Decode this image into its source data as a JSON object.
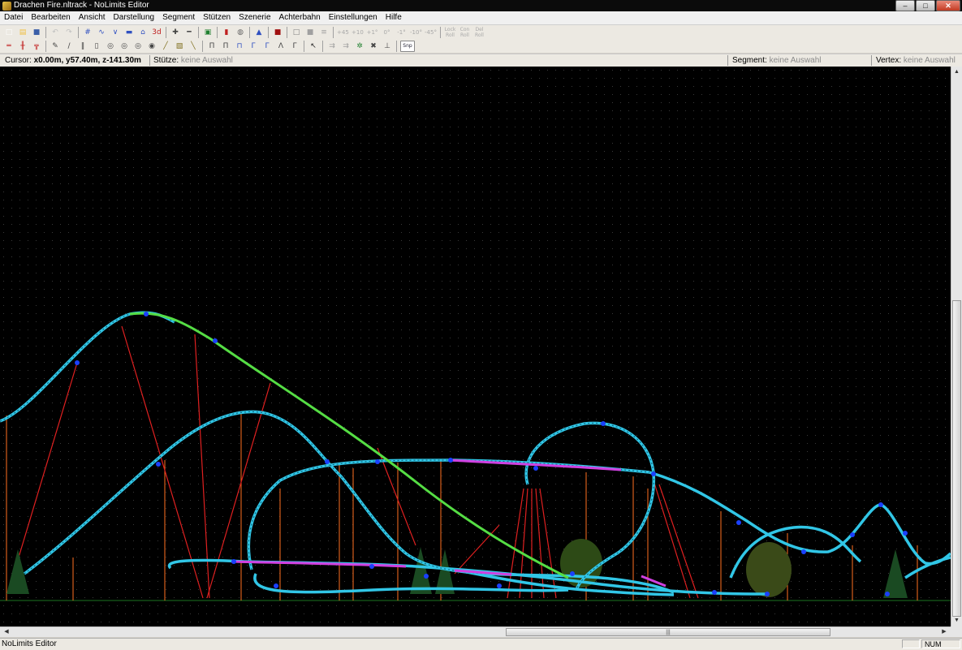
{
  "window": {
    "title": "Drachen Fire.nltrack - NoLimits Editor",
    "app_icon": "coaster-app-icon",
    "buttons": {
      "minimize": "–",
      "maximize": "□",
      "close": "✕"
    }
  },
  "menu": [
    {
      "label": "Datei"
    },
    {
      "label": "Bearbeiten"
    },
    {
      "label": "Ansicht"
    },
    {
      "label": "Darstellung"
    },
    {
      "label": "Segment"
    },
    {
      "label": "Stützen"
    },
    {
      "label": "Szenerie"
    },
    {
      "label": "Achterbahn"
    },
    {
      "label": "Einstellungen"
    },
    {
      "label": "Hilfe"
    }
  ],
  "toolbar1": {
    "buttons": [
      {
        "name": "new-file-icon",
        "glyph": "□",
        "color": "#ffffff"
      },
      {
        "name": "open-folder-icon",
        "glyph": "▤",
        "color": "#f0c040"
      },
      {
        "name": "save-disk-icon",
        "glyph": "■",
        "color": "#3a5fa8"
      },
      {
        "name": "sep"
      },
      {
        "name": "undo-icon",
        "glyph": "↶",
        "color": "#c0c0c0"
      },
      {
        "name": "redo-icon",
        "glyph": "↷",
        "color": "#c0c0c0"
      },
      {
        "name": "sep"
      },
      {
        "name": "grid-icon",
        "glyph": "#",
        "color": "#3050c0"
      },
      {
        "name": "track-wave-icon",
        "glyph": "∿",
        "color": "#3050c0"
      },
      {
        "name": "track-dip-icon",
        "glyph": "∨",
        "color": "#3050c0"
      },
      {
        "name": "train-icon",
        "glyph": "▬",
        "color": "#3050c0"
      },
      {
        "name": "station-icon",
        "glyph": "⌂",
        "color": "#3050c0"
      },
      {
        "name": "view-3d-icon",
        "glyph": "3d",
        "color": "#c02020"
      },
      {
        "name": "sep"
      },
      {
        "name": "add-vertex-icon",
        "glyph": "✚",
        "color": "#444444"
      },
      {
        "name": "remove-vertex-icon",
        "glyph": "━",
        "color": "#444444"
      },
      {
        "name": "sep"
      },
      {
        "name": "render-icon",
        "glyph": "▣",
        "color": "#208030"
      },
      {
        "name": "sep"
      },
      {
        "name": "terrain-icon",
        "glyph": "▮",
        "color": "#c02020"
      },
      {
        "name": "globe-icon",
        "glyph": "◍",
        "color": "#666666"
      },
      {
        "name": "sep"
      },
      {
        "name": "support-tower-icon",
        "glyph": "▲",
        "color": "#3050c0"
      },
      {
        "name": "sep"
      },
      {
        "name": "record-icon",
        "glyph": "■",
        "color": "#a01010"
      },
      {
        "name": "sep"
      },
      {
        "name": "window-icon",
        "glyph": "□",
        "color": "#808080"
      },
      {
        "name": "box-icon",
        "glyph": "■",
        "color": "#a0a0a0"
      },
      {
        "name": "align-icon",
        "glyph": "≡",
        "color": "#a0a0a0"
      },
      {
        "name": "sep"
      }
    ],
    "angle_labels": [
      "+45°",
      "+10°",
      "+1°",
      "0°",
      "-1°",
      "-10°",
      "-45°"
    ],
    "roll_labels": [
      "Lock Roll",
      "Con Roll",
      "Del Roll"
    ]
  },
  "toolbar2": {
    "buttons": [
      {
        "name": "track-piece-icon",
        "glyph": "═",
        "color": "#c02020"
      },
      {
        "name": "split-segment-icon",
        "glyph": "╫",
        "color": "#c02020"
      },
      {
        "name": "join-segment-icon",
        "glyph": "╦",
        "color": "#c02020"
      },
      {
        "name": "sep"
      },
      {
        "name": "pencil-icon",
        "glyph": "✎",
        "color": "#444444"
      },
      {
        "name": "ruler-icon",
        "glyph": "∕",
        "color": "#444444"
      },
      {
        "name": "pillar-thin-icon",
        "glyph": "‖",
        "color": "#444444"
      },
      {
        "name": "pillar-icon",
        "glyph": "▯",
        "color": "#444444"
      },
      {
        "name": "cylinder-a-icon",
        "glyph": "◎",
        "color": "#444444"
      },
      {
        "name": "cylinder-b-icon",
        "glyph": "◎",
        "color": "#444444"
      },
      {
        "name": "cylinder-c-icon",
        "glyph": "◎",
        "color": "#444444"
      },
      {
        "name": "footer-icon",
        "glyph": "◉",
        "color": "#444444"
      },
      {
        "name": "brush-icon",
        "glyph": "╱",
        "color": "#807020"
      },
      {
        "name": "block-icon",
        "glyph": "▧",
        "color": "#807020"
      },
      {
        "name": "beam-icon",
        "glyph": "╲",
        "color": "#807020"
      },
      {
        "name": "sep"
      },
      {
        "name": "support-a-icon",
        "glyph": "Π",
        "color": "#444444"
      },
      {
        "name": "support-b-icon",
        "glyph": "Π",
        "color": "#444444"
      },
      {
        "name": "support-c-icon",
        "glyph": "⊓",
        "color": "#3050c0"
      },
      {
        "name": "support-d-icon",
        "glyph": "Γ",
        "color": "#3050c0"
      },
      {
        "name": "support-e-icon",
        "glyph": "Γ",
        "color": "#3050c0"
      },
      {
        "name": "support-f-icon",
        "glyph": "Λ",
        "color": "#444444"
      },
      {
        "name": "support-g-icon",
        "glyph": "Γ",
        "color": "#444444"
      },
      {
        "name": "sep"
      },
      {
        "name": "select-arrow-icon",
        "glyph": "↖",
        "color": "#222222"
      },
      {
        "name": "sep"
      },
      {
        "name": "add-node-icon",
        "glyph": "⇉",
        "color": "#a0a0a0"
      },
      {
        "name": "add-free-node-icon",
        "glyph": "⇉",
        "color": "#a0a0a0"
      },
      {
        "name": "add-green-icon",
        "glyph": "✲",
        "color": "#208030"
      },
      {
        "name": "add-cross-icon",
        "glyph": "✖",
        "color": "#444444"
      },
      {
        "name": "anchor-icon",
        "glyph": "⊥",
        "color": "#444444"
      },
      {
        "name": "sep"
      }
    ],
    "snap_label": "Snp"
  },
  "info": {
    "cursor_label": "Cursor:",
    "cursor_value": "x0.00m, y57.40m, z-141.30m",
    "support_label": "Stütze:",
    "support_value": "keine Auswahl",
    "segment_label": "Segment:",
    "segment_value": "keine Auswahl",
    "vertex_label": "Vertex:",
    "vertex_value": "keine Auswahl"
  },
  "scene": {
    "background": "#000000",
    "grid_dot_color": "#3a3a3a",
    "ground_color": "#0e3a10",
    "track_color": "#31c6e6",
    "lift_color": "#55dd44",
    "brake_color": "#d040e0",
    "support_color": "#e02020",
    "support_thin_color": "#ff7020",
    "node_color": "#1a40ff",
    "tree_color": "#1a4a22"
  },
  "status": {
    "text": "NoLimits Editor",
    "num": "NUM"
  }
}
